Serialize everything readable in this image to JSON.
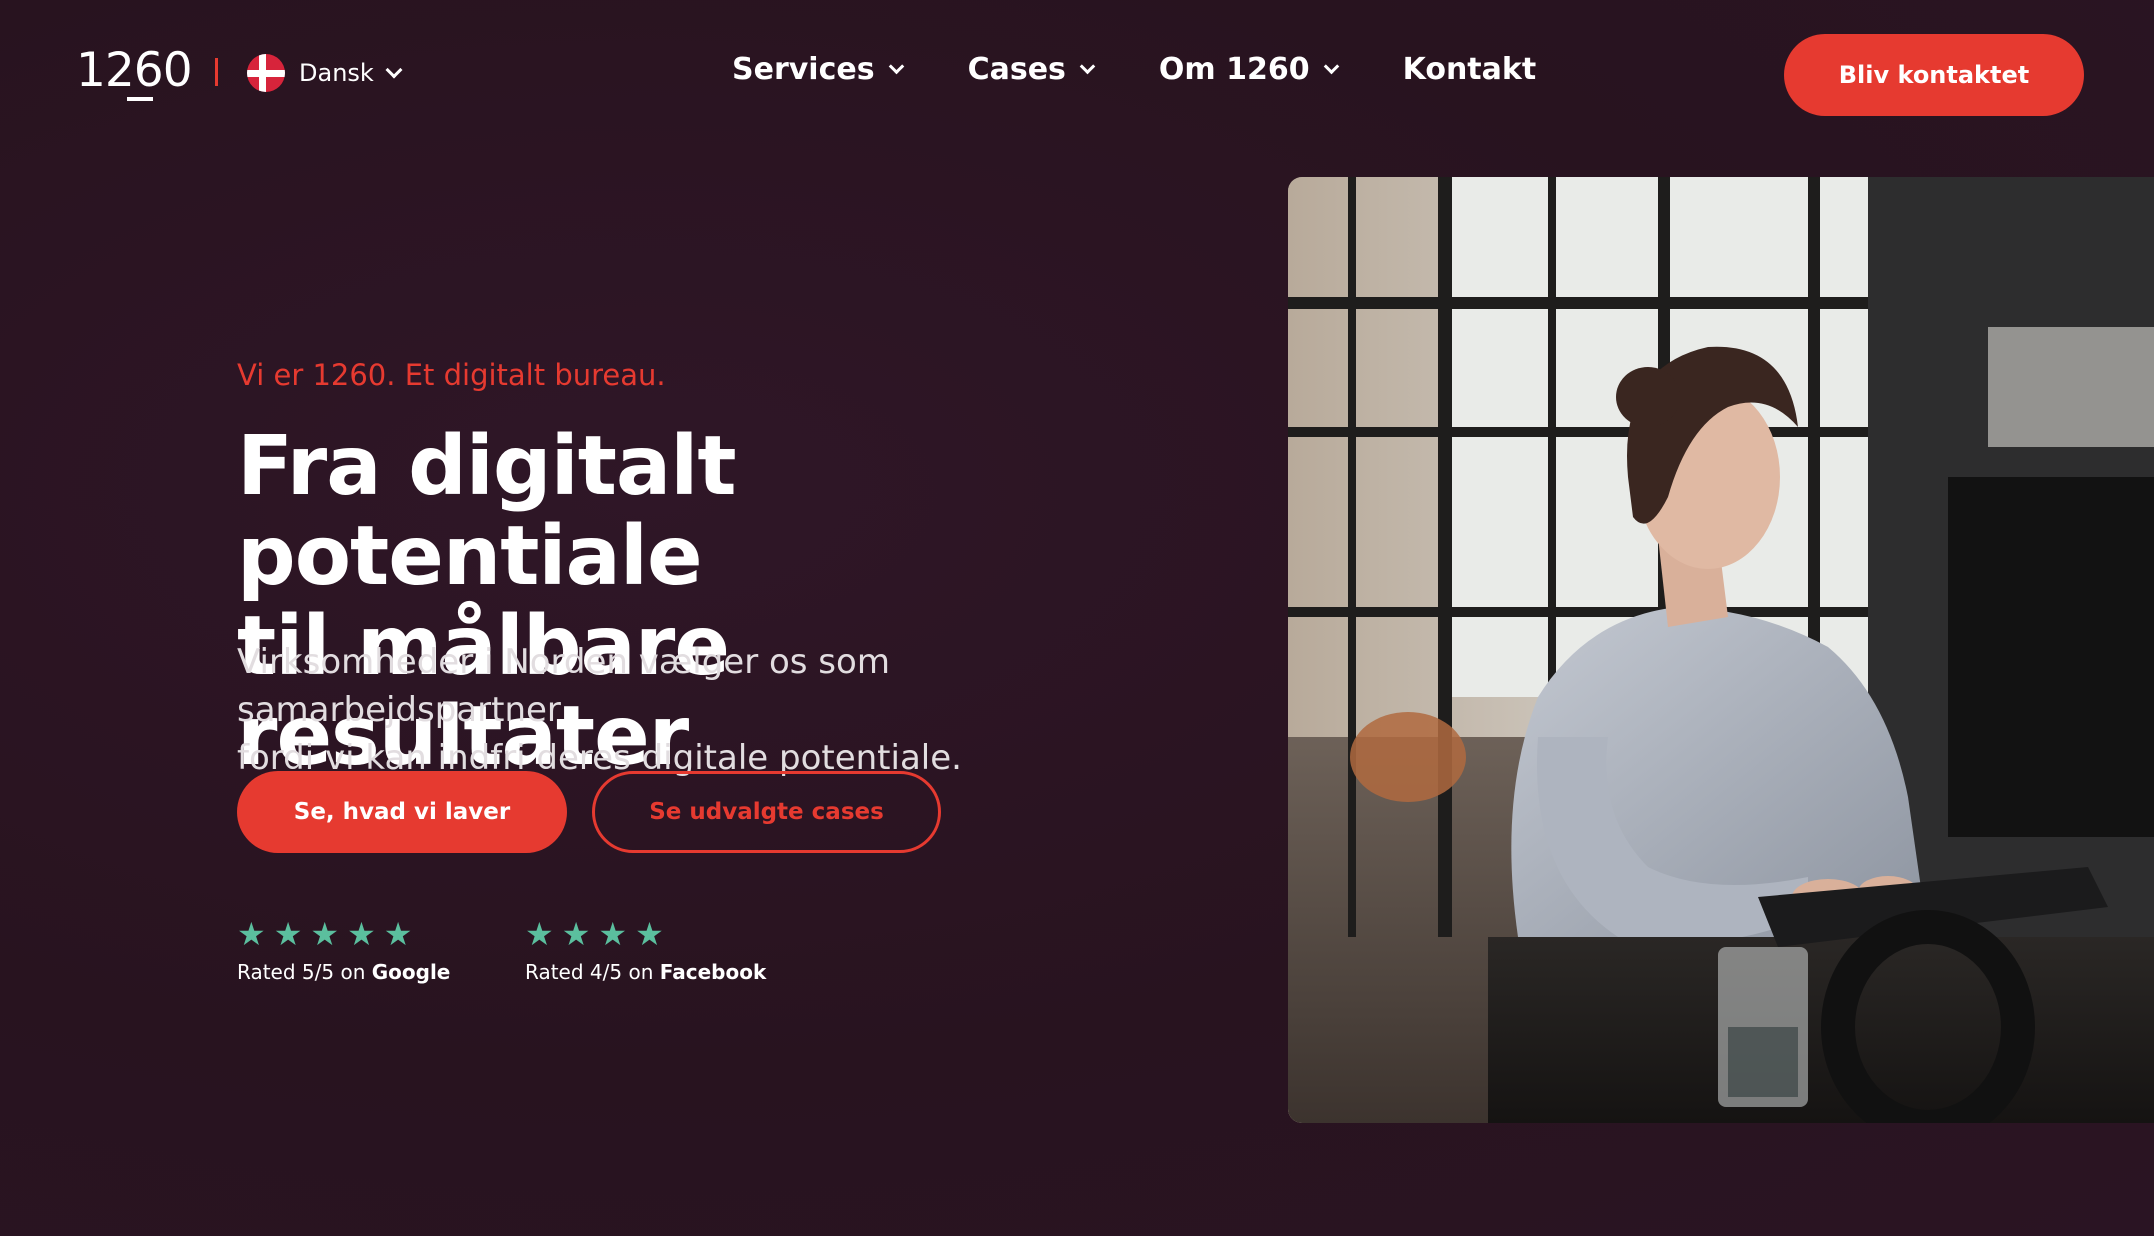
{
  "header": {
    "logo": "1260",
    "language": "Dansk",
    "nav": [
      {
        "label": "Services",
        "has_dropdown": true
      },
      {
        "label": "Cases",
        "has_dropdown": true
      },
      {
        "label": "Om 1260",
        "has_dropdown": true
      },
      {
        "label": "Kontakt",
        "has_dropdown": false
      }
    ],
    "cta_label": "Bliv kontaktet"
  },
  "hero": {
    "tagline": "Vi er 1260. Et digitalt bureau.",
    "headline_line1": "Fra digitalt potentiale",
    "headline_line2": "til målbare resultater",
    "subhead_line1": "Virksomheder i Norden vælger os som samarbejdspartner",
    "subhead_line2": "fordi vi kan indfri deres digitale potentiale.",
    "primary_button": "Se, hvad vi laver",
    "secondary_button": "Se udvalgte cases"
  },
  "ratings": [
    {
      "prefix": "Rated 5/5 on",
      "platform": "Google",
      "stars": 5
    },
    {
      "prefix": "Rated 4/5 on",
      "platform": "Facebook",
      "stars": 4
    }
  ],
  "colors": {
    "background": "#2a1423",
    "accent": "#e63a30",
    "star": "#5bbf9e"
  }
}
